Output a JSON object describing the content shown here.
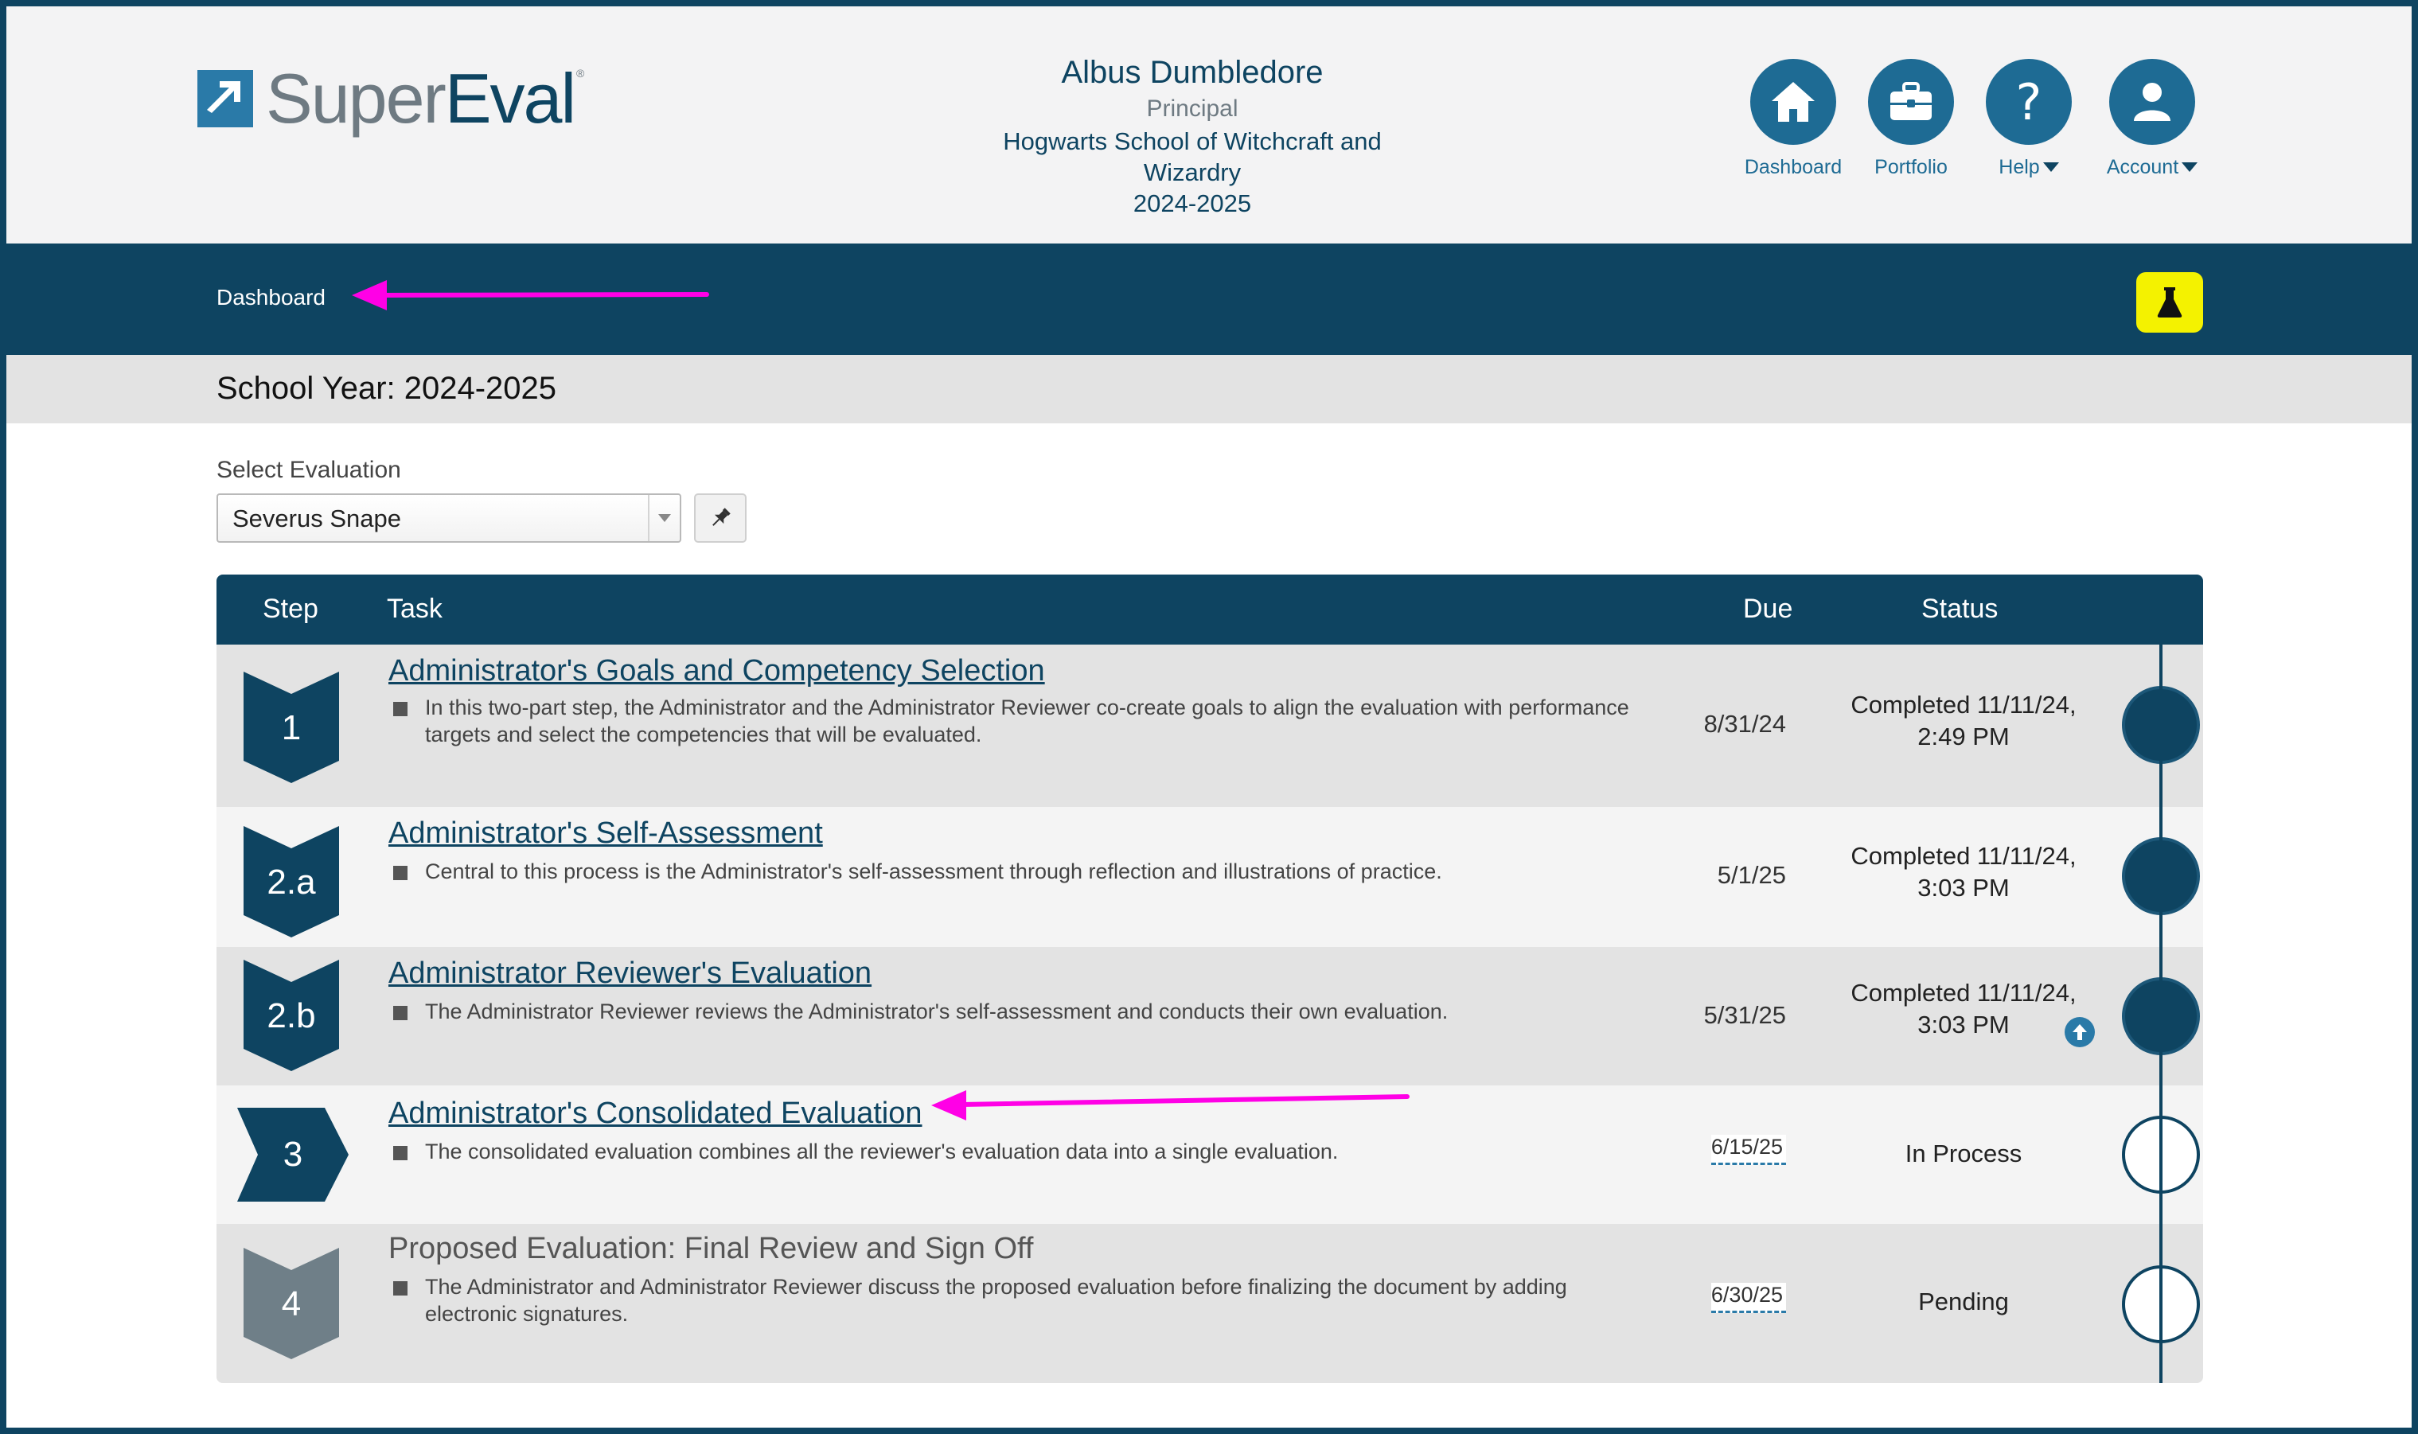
{
  "header": {
    "logo": {
      "word_super": "Super",
      "word_eval": "Eval",
      "trademark": "®"
    },
    "user": {
      "name": "Albus Dumbledore",
      "role": "Principal",
      "school_line1": "Hogwarts School of Witchcraft and",
      "school_line2": "Wizardry",
      "year": "2024-2025"
    },
    "nav": [
      {
        "label": "Dashboard",
        "icon": "home-icon"
      },
      {
        "label": "Portfolio",
        "icon": "briefcase-icon"
      },
      {
        "label": "Help",
        "icon": "question-icon",
        "has_dropdown": true
      },
      {
        "label": "Account",
        "icon": "person-icon",
        "has_dropdown": true
      }
    ]
  },
  "navbar": {
    "breadcrumb": "Dashboard",
    "flask_icon": "flask-icon",
    "flask_color": "#f4f200"
  },
  "school_year": {
    "label": "School Year: 2024-2025"
  },
  "select_evaluation": {
    "label": "Select Evaluation",
    "value": "Severus Snape",
    "pin_icon": "pin-icon"
  },
  "table": {
    "headers": {
      "step": "Step",
      "task": "Task",
      "due": "Due",
      "status": "Status"
    },
    "rows": [
      {
        "step": "1",
        "title": "Administrator's Goals and Competency Selection",
        "desc": "In this two-part step, the Administrator and the Administrator Reviewer co-create goals to align the evaluation with performance targets and select the competencies that will be evaluated.",
        "due": "8/31/24",
        "status_line1": "Completed 11/11/24,",
        "status_line2": "2:49 PM",
        "state": "completed"
      },
      {
        "step": "2.a",
        "title": "Administrator's Self-Assessment",
        "desc": "Central to this process is the Administrator's self-assessment through reflection and illustrations of practice.",
        "due": "5/1/25",
        "status_line1": "Completed 11/11/24,",
        "status_line2": "3:03 PM",
        "state": "completed"
      },
      {
        "step": "2.b",
        "title": "Administrator Reviewer's Evaluation",
        "desc": "The Administrator Reviewer reviews the Administrator's self-assessment and conducts their own evaluation.",
        "due": "5/31/25",
        "status_line1": "Completed 11/11/24,",
        "status_line2": "3:03 PM",
        "state": "completed"
      },
      {
        "step": "3",
        "title": "Administrator's Consolidated Evaluation",
        "desc": "The consolidated evaluation combines all the reviewer's evaluation data into a single evaluation.",
        "due": "6/15/25",
        "status_line1": "In Process",
        "state": "current"
      },
      {
        "step": "4",
        "title": "Proposed Evaluation: Final Review and Sign Off",
        "desc": "The Administrator and Administrator Reviewer discuss the proposed evaluation before finalizing the document by adding electronic signatures.",
        "due": "6/30/25",
        "status_line1": "Pending",
        "state": "pending"
      }
    ]
  },
  "colors": {
    "primary": "#0e4461",
    "accent": "#1e6b94",
    "annotation_arrow": "#ff00e6",
    "pending_badge": "#6f7f88"
  }
}
